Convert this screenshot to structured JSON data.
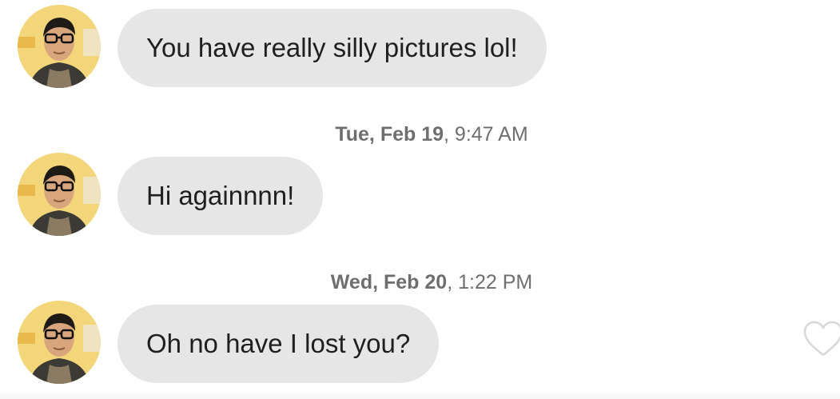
{
  "messages": [
    {
      "text": "You have really silly pictures lol!"
    },
    {
      "text": "Hi againnnn!"
    },
    {
      "text": "Oh no have I lost you?"
    }
  ],
  "timestamps": [
    {
      "day": "Tue, Feb 19",
      "time": ", 9:47 AM"
    },
    {
      "day": "Wed, Feb 20",
      "time": ", 1:22 PM"
    }
  ],
  "icons": {
    "avatar": "user-avatar",
    "like": "heart-outline-icon"
  },
  "colors": {
    "bubble": "#e6e6e6",
    "text": "#1f1f1f",
    "timestamp": "#6e6e6e"
  }
}
